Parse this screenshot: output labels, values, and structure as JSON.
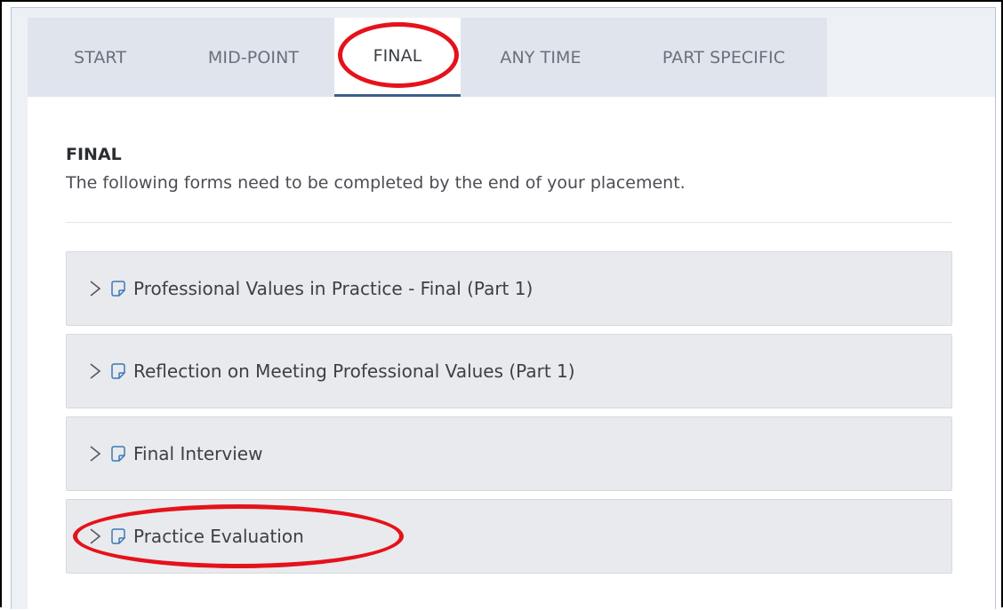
{
  "tabs": [
    {
      "label": "START",
      "active": false
    },
    {
      "label": "MID-POINT",
      "active": false
    },
    {
      "label": "FINAL",
      "active": true
    },
    {
      "label": "ANY TIME",
      "active": false
    },
    {
      "label": "PART SPECIFIC",
      "active": false
    }
  ],
  "section": {
    "title": "FINAL",
    "description": "The following forms need to be completed by the end of your placement."
  },
  "forms": [
    {
      "label": "Professional Values in Practice - Final (Part 1)",
      "icon": "form-document-icon"
    },
    {
      "label": "Reflection on Meeting Professional Values (Part 1)",
      "icon": "form-document-icon"
    },
    {
      "label": "Final Interview",
      "icon": "form-document-icon"
    },
    {
      "label": "Practice Evaluation",
      "icon": "form-document-icon"
    }
  ],
  "annotations": {
    "color": "#e5121b",
    "highlighted": [
      "FINAL",
      "Practice Evaluation"
    ]
  },
  "colors": {
    "active_tab_underline": "#3f5f8a",
    "tabbar_background": "#dfe4ed",
    "item_background": "#e8eaed"
  }
}
